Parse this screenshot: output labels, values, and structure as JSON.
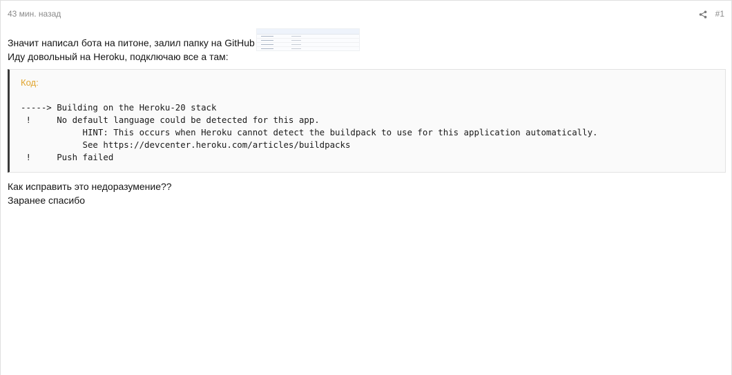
{
  "post": {
    "time": "43 мин. назад",
    "number": "#1",
    "icons": {
      "share": "share-icon",
      "screenshot": "image-thumbnail"
    },
    "colors": {
      "code_label": "#e0a32a",
      "code_border": "#3a3a3a"
    },
    "text_line_1": "Значит написал бота на питоне, залил папку на GitHub",
    "text_line_2": "Иду довольный на Heroku, подключаю все а там:",
    "code": {
      "label": "Код:",
      "lines": [
        "-----> Building on the Heroku-20 stack",
        " !     No default language could be detected for this app.",
        "            HINT: This occurs when Heroku cannot detect the buildpack to use for this application automatically.",
        "            See https://devcenter.heroku.com/articles/buildpacks",
        " !     Push failed"
      ]
    },
    "text_line_3": "Как исправить это недоразумение??",
    "text_line_4": "Заранее спасибо"
  }
}
